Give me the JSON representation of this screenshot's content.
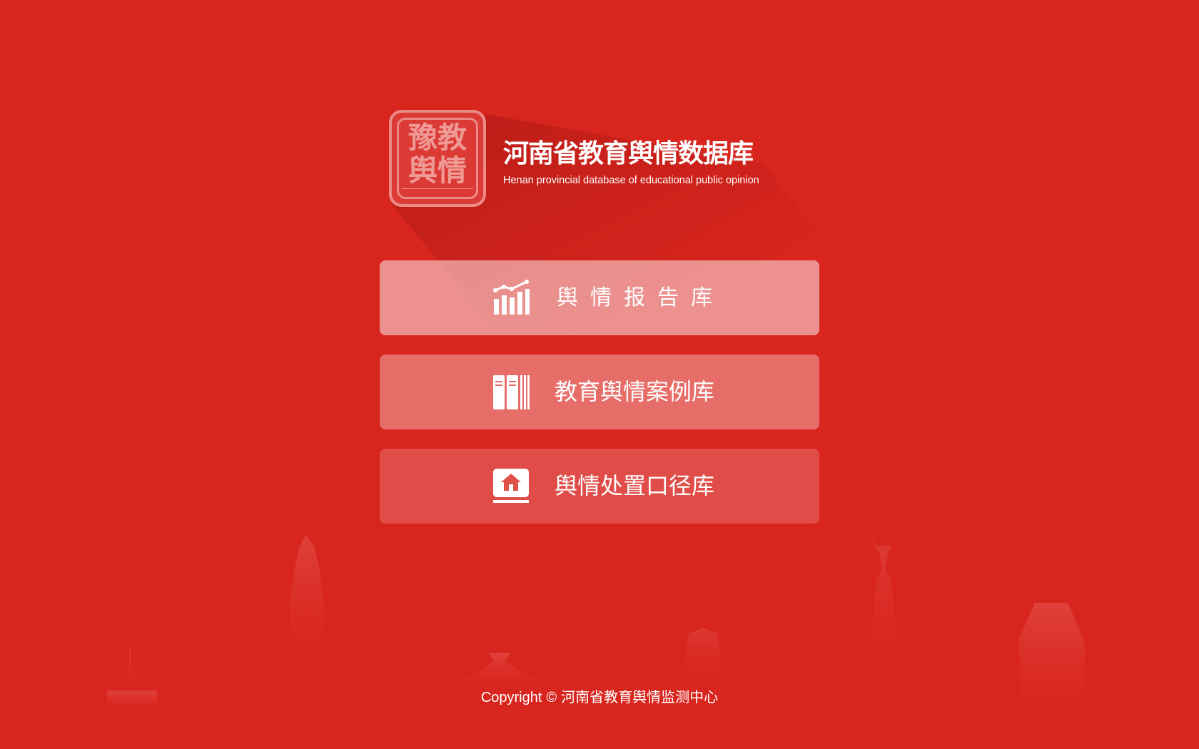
{
  "header": {
    "logo": {
      "chars": "豫教舆情",
      "strip_text": ""
    },
    "title_cn": "河南省教育舆情数据库",
    "title_en": "Henan provincial database of educational public opinion"
  },
  "menu": {
    "items": [
      {
        "label": "舆情报告库",
        "icon": "report-chart-icon"
      },
      {
        "label": "教育舆情案例库",
        "icon": "books-icon"
      },
      {
        "label": "舆情处置口径库",
        "icon": "house-screen-icon"
      }
    ]
  },
  "footer": {
    "copyright_prefix": "Copyright",
    "copyright_symbol": "©",
    "copyright_org": "河南省教育舆情监测中心"
  },
  "colors": {
    "background": "#d8251e",
    "logo_border": "#ec8a86",
    "text": "#ffffff"
  }
}
